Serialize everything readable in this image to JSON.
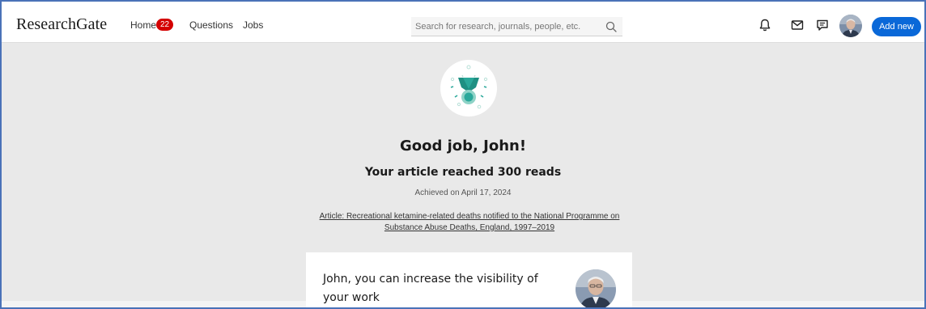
{
  "header": {
    "logo": "ResearchGate",
    "nav": [
      {
        "label": "Home",
        "badge": "22"
      },
      {
        "label": "Questions"
      },
      {
        "label": "Jobs"
      }
    ],
    "search": {
      "placeholder": "Search for research, journals, people, etc.",
      "icon": "search-icon"
    },
    "icons": [
      "bell-icon",
      "mail-icon",
      "chat-icon"
    ],
    "add_button": "Add new"
  },
  "main": {
    "medal_icon": "medal-icon",
    "headline": "Good job, John!",
    "subhead": "Your article reached 300 reads",
    "achieved": "Achieved on April 17, 2024",
    "article_line1": "Article: Recreational ketamine-related deaths notified to the National Programme on",
    "article_line2": "Substance Abuse Deaths, England, 1997–2019",
    "card_text": "John, you can increase the visibility of your work"
  },
  "colors": {
    "accent": "#0a68d8",
    "badge": "#d40000",
    "medal_teal": "#2aa89a",
    "background": "#e9e9e9"
  }
}
